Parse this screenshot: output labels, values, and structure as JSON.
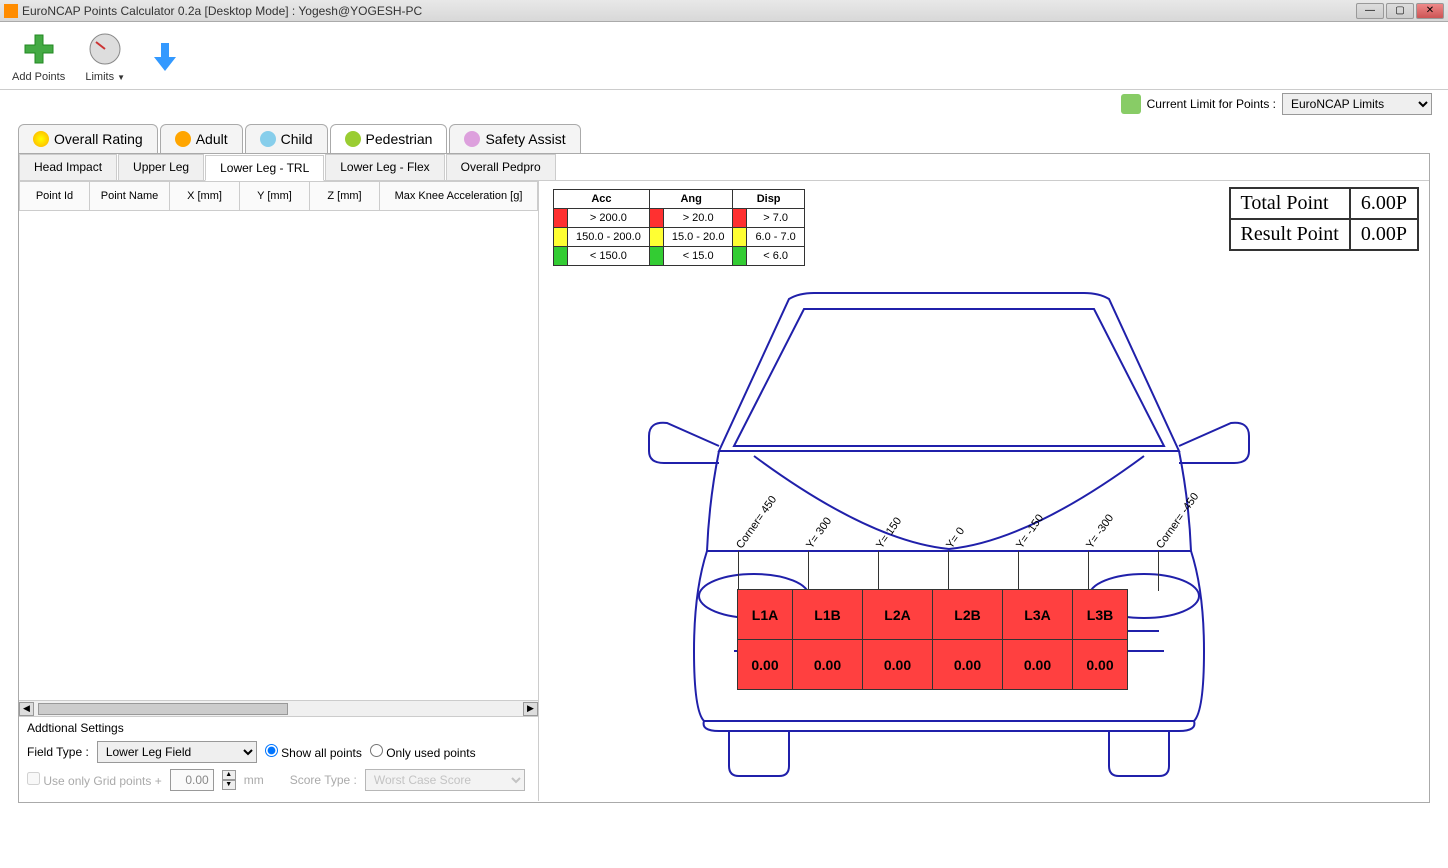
{
  "window": {
    "title": "EuroNCAP Points Calculator 0.2a [Desktop Mode] : Yogesh@YOGESH-PC"
  },
  "toolbar": {
    "add_points": "Add Points",
    "limits": "Limits"
  },
  "subbar": {
    "label": "Current Limit for Points :",
    "selected": "EuroNCAP Limits"
  },
  "main_tabs": {
    "overall": "Overall Rating",
    "adult": "Adult",
    "child": "Child",
    "pedestrian": "Pedestrian",
    "safety": "Safety Assist"
  },
  "sub_tabs": {
    "head": "Head Impact",
    "upper": "Upper Leg",
    "lower_trl": "Lower Leg - TRL",
    "lower_flex": "Lower Leg - Flex",
    "overall_ped": "Overall Pedpro"
  },
  "table_headers": {
    "point_id": "Point Id",
    "point_name": "Point Name",
    "x": "X [mm]",
    "y": "Y [mm]",
    "z": "Z [mm]",
    "max_knee": "Max Knee Acceleration [g]"
  },
  "settings": {
    "title": "Addtional Settings",
    "field_type_label": "Field Type  :",
    "field_type_value": "Lower Leg Field",
    "show_all": "Show all points",
    "only_used": "Only used points",
    "grid_label": "Use only Grid points +",
    "grid_value": "0.00",
    "grid_unit": "mm",
    "score_type_label": "Score Type :",
    "score_type_value": "Worst Case Score"
  },
  "legend": {
    "headers": {
      "acc": "Acc",
      "ang": "Ang",
      "disp": "Disp"
    },
    "rows": [
      {
        "acc": "> 200.0",
        "ang": "> 20.0",
        "disp": "> 7.0"
      },
      {
        "acc": "150.0 - 200.0",
        "ang": "15.0 - 20.0",
        "disp": "6.0 - 7.0"
      },
      {
        "acc": "< 150.0",
        "ang": "< 15.0",
        "disp": "< 6.0"
      }
    ]
  },
  "results": {
    "total_label": "Total Point",
    "total_value": "6.00P",
    "result_label": "Result Point",
    "result_value": "0.00P"
  },
  "grid_labels": {
    "corner_l": "Corner= 450",
    "y300": "Y= 300",
    "y150": "Y= 150",
    "y0": "Y= 0",
    "ym150": "Y= -150",
    "ym300": "Y= -300",
    "corner_r": "Corner= -450"
  },
  "zones": {
    "names": [
      "L1A",
      "L1B",
      "L2A",
      "L2B",
      "L3A",
      "L3B"
    ],
    "values": [
      "0.00",
      "0.00",
      "0.00",
      "0.00",
      "0.00",
      "0.00"
    ]
  }
}
